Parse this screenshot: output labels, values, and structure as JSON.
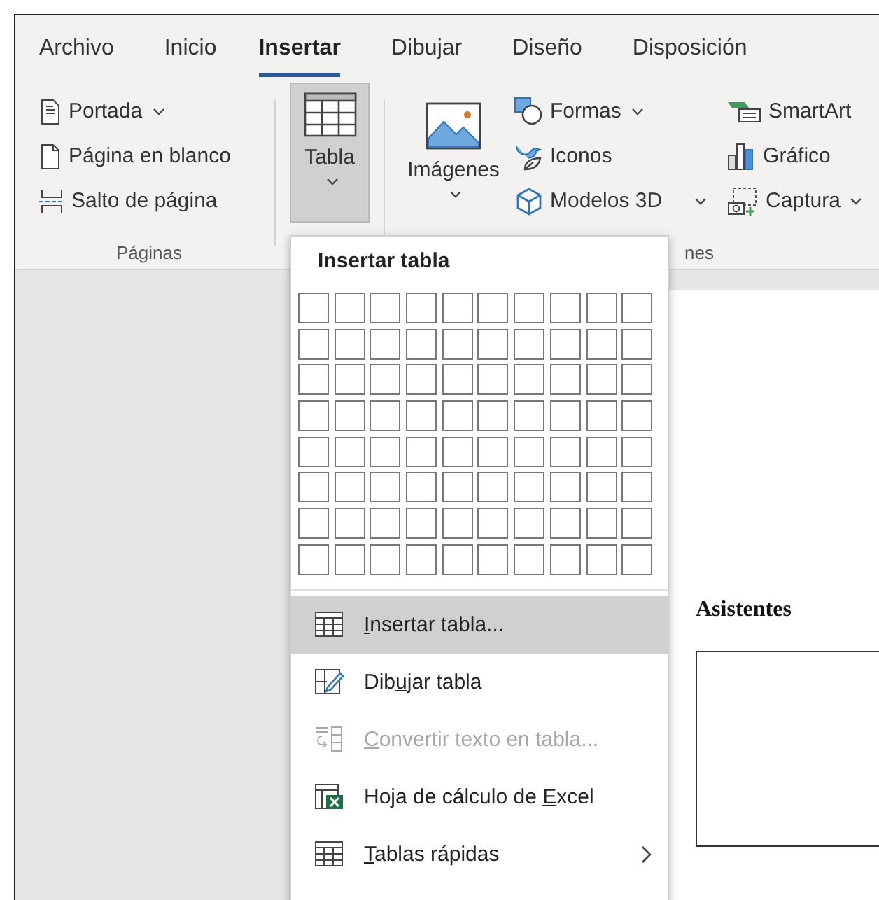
{
  "tabs": [
    {
      "label": "Archivo",
      "selected": false
    },
    {
      "label": "Inicio",
      "selected": false
    },
    {
      "label": "Insertar",
      "selected": true
    },
    {
      "label": "Dibujar",
      "selected": false
    },
    {
      "label": "Diseño",
      "selected": false
    },
    {
      "label": "Disposición",
      "selected": false
    }
  ],
  "pages_group": {
    "label": "Páginas",
    "items": [
      {
        "kind": "cover",
        "label": "Portada",
        "has_menu": true
      },
      {
        "kind": "blank",
        "label": "Página en blanco",
        "has_menu": false
      },
      {
        "kind": "break",
        "label": "Salto de página",
        "has_menu": false
      }
    ]
  },
  "table_button": {
    "label": "Tabla",
    "selected": true
  },
  "images_button": {
    "label": "Imágenes"
  },
  "illustrations_group": {
    "label": "nes",
    "columns": [
      [
        {
          "kind": "shapes",
          "label": "Formas",
          "has_menu": true
        },
        {
          "kind": "icons",
          "label": "Iconos",
          "has_menu": false
        },
        {
          "kind": "models",
          "label": "Modelos 3D",
          "has_menu": true
        }
      ],
      [
        {
          "kind": "smartart",
          "label": "SmartArt",
          "has_menu": false
        },
        {
          "kind": "chart",
          "label": "Gráfico",
          "has_menu": false
        },
        {
          "kind": "capture",
          "label": "Captura",
          "has_menu": true
        }
      ]
    ]
  },
  "table_menu": {
    "title": "Insertar tabla",
    "grid": [
      [
        {
          "selected": false
        },
        {
          "selected": false
        },
        {
          "selected": false
        },
        {
          "selected": false
        },
        {
          "selected": false
        },
        {
          "selected": false
        },
        {
          "selected": false
        },
        {
          "selected": false
        },
        {
          "selected": false
        },
        {
          "selected": false
        }
      ],
      [
        {
          "selected": false
        },
        {
          "selected": false
        },
        {
          "selected": false
        },
        {
          "selected": false
        },
        {
          "selected": false
        },
        {
          "selected": false
        },
        {
          "selected": false
        },
        {
          "selected": false
        },
        {
          "selected": false
        },
        {
          "selected": false
        }
      ],
      [
        {
          "selected": false
        },
        {
          "selected": false
        },
        {
          "selected": false
        },
        {
          "selected": false
        },
        {
          "selected": false
        },
        {
          "selected": false
        },
        {
          "selected": false
        },
        {
          "selected": false
        },
        {
          "selected": false
        },
        {
          "selected": false
        }
      ],
      [
        {
          "selected": false
        },
        {
          "selected": false
        },
        {
          "selected": false
        },
        {
          "selected": false
        },
        {
          "selected": false
        },
        {
          "selected": false
        },
        {
          "selected": false
        },
        {
          "selected": false
        },
        {
          "selected": false
        },
        {
          "selected": false
        }
      ],
      [
        {
          "selected": false
        },
        {
          "selected": false
        },
        {
          "selected": false
        },
        {
          "selected": false
        },
        {
          "selected": false
        },
        {
          "selected": false
        },
        {
          "selected": false
        },
        {
          "selected": false
        },
        {
          "selected": false
        },
        {
          "selected": false
        }
      ],
      [
        {
          "selected": false
        },
        {
          "selected": false
        },
        {
          "selected": false
        },
        {
          "selected": false
        },
        {
          "selected": false
        },
        {
          "selected": false
        },
        {
          "selected": false
        },
        {
          "selected": false
        },
        {
          "selected": false
        },
        {
          "selected": false
        }
      ],
      [
        {
          "selected": false
        },
        {
          "selected": false
        },
        {
          "selected": false
        },
        {
          "selected": false
        },
        {
          "selected": false
        },
        {
          "selected": false
        },
        {
          "selected": false
        },
        {
          "selected": false
        },
        {
          "selected": false
        },
        {
          "selected": false
        }
      ],
      [
        {
          "selected": false
        },
        {
          "selected": false
        },
        {
          "selected": false
        },
        {
          "selected": false
        },
        {
          "selected": false
        },
        {
          "selected": false
        },
        {
          "selected": false
        },
        {
          "selected": false
        },
        {
          "selected": false
        },
        {
          "selected": false
        }
      ]
    ],
    "items": [
      {
        "kind": "insert",
        "key": "I",
        "after": "nsertar tabla...",
        "highlighted": true,
        "disabled": false,
        "submenu": false
      },
      {
        "kind": "draw",
        "before": "Dib",
        "key": "u",
        "after": "jar tabla",
        "highlighted": false,
        "disabled": false,
        "submenu": false
      },
      {
        "kind": "convert",
        "key": "C",
        "after": "onvertir texto en tabla...",
        "highlighted": false,
        "disabled": true,
        "submenu": false
      },
      {
        "kind": "excel",
        "before": "Hoja de cálculo de ",
        "key": "E",
        "after": "xcel",
        "highlighted": false,
        "disabled": false,
        "submenu": false
      },
      {
        "kind": "quick",
        "key": "T",
        "after": "ablas rápidas",
        "highlighted": false,
        "disabled": false,
        "submenu": true
      }
    ]
  },
  "document": {
    "heading": "Asistentes"
  }
}
